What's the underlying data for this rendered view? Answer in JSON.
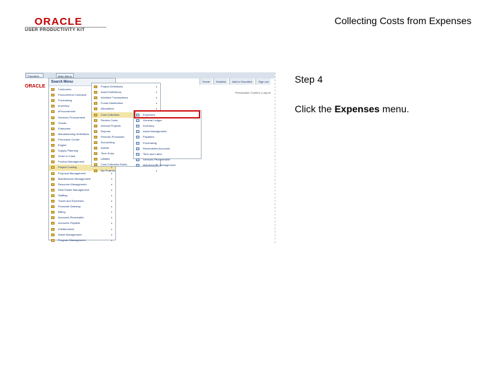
{
  "header": {
    "logo_oracle": "ORACLE",
    "logo_subtitle": "USER PRODUCTIVITY KIT",
    "title": "Collecting Costs from Expenses"
  },
  "step": {
    "label": "Step 4",
    "instruction_prefix": "Click the ",
    "instruction_target": "Expenses",
    "instruction_suffix": " menu."
  },
  "screenshot": {
    "nav_tabs": [
      "Favorites",
      "Main Menu"
    ],
    "brand": "ORACLE",
    "top_links": [
      "Home",
      "Worklist",
      "Add to Favorites",
      "Sign out"
    ],
    "personalize": "Personalize Content | Layout",
    "menu_title": "Search Menu:",
    "col1": [
      "Customers",
      "Procurement Contracts",
      "Purchasing",
      "Inventory",
      "eProcurement",
      "Services Procurement",
      "Grants",
      "Enterprise",
      "Manufacturing Definitions",
      "Promotion Center",
      "Engine",
      "Supply Planning",
      "Order to Cash",
      "Product Management",
      "Project Costing",
      "Proposal Management",
      "Maintenance Management",
      "Resource Management",
      "Real Estate Management",
      "Staffing",
      "Travel and Expenses",
      "Financial Gateway",
      "Billing",
      "Accounts Receivable",
      "Accounts Payable",
      "eSettlements",
      "Asset Management",
      "Program Management"
    ],
    "col1_selected": 14,
    "col2": [
      "Project Definitions",
      "Asset Definitions",
      "Interface Transactions",
      "Funds Distribution",
      "Allocations",
      "Cost Collection",
      "Review Costs",
      "Internal Projects",
      "Reports",
      "Periodic Processes",
      "Accounting",
      "Assets",
      "Time Entry",
      "Utilities",
      "Cost Collection Rules",
      "My Projects"
    ],
    "col2_selected": 5,
    "col3": [
      "Expenses",
      "General Ledger",
      "Inventory",
      "Asset Management",
      "Payables",
      "Purchasing",
      "Receivables Accounts",
      "Time and Labor",
      "Services Procurement",
      "Maintenance Management"
    ],
    "col3_target": 0
  }
}
